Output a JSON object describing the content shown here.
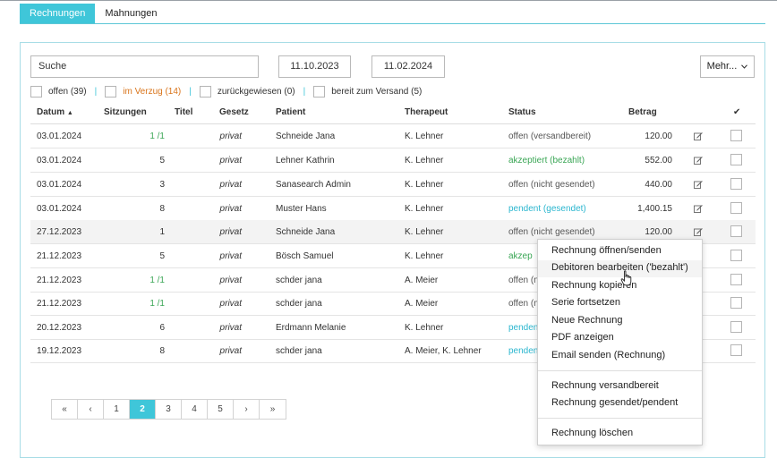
{
  "tabs": [
    {
      "label": "Rechnungen",
      "active": true
    },
    {
      "label": "Mahnungen",
      "active": false
    }
  ],
  "toolbar": {
    "search_placeholder": "Suche",
    "date_from": "11.10.2023",
    "date_to": "11.02.2024",
    "more_label": "Mehr..."
  },
  "filters": [
    {
      "label": "offen (39)",
      "color": "#333333"
    },
    {
      "label": "im Verzug (14)",
      "color": "#d9741a"
    },
    {
      "label": "zurückgewiesen (0)",
      "color": "#333333"
    },
    {
      "label": "bereit zum Versand (5)",
      "color": "#333333"
    }
  ],
  "table": {
    "headers": {
      "datum": "Datum",
      "sort_indicator": "▲",
      "sitzungen": "Sitzungen",
      "titel": "Titel",
      "gesetz": "Gesetz",
      "patient": "Patient",
      "therapeut": "Therapeut",
      "status": "Status",
      "betrag": "Betrag",
      "check": "✔"
    },
    "rows": [
      {
        "datum": "03.01.2024",
        "sitzungen": "1 /1",
        "sitz_green": true,
        "gesetz": "privat",
        "patient": "Schneide Jana",
        "therapeut": "K. Lehner",
        "status": "offen (versandbereit)",
        "status_color": "grey",
        "betrag": "120.00"
      },
      {
        "datum": "03.01.2024",
        "sitzungen": "5",
        "sitz_green": false,
        "gesetz": "privat",
        "patient": "Lehner Kathrin",
        "therapeut": "K. Lehner",
        "status": "akzeptiert (bezahlt)",
        "status_color": "green",
        "betrag": "552.00"
      },
      {
        "datum": "03.01.2024",
        "sitzungen": "3",
        "sitz_green": false,
        "gesetz": "privat",
        "patient": "Sanasearch Admin",
        "therapeut": "K. Lehner",
        "status": "offen (nicht gesendet)",
        "status_color": "grey",
        "betrag": "440.00"
      },
      {
        "datum": "03.01.2024",
        "sitzungen": "8",
        "sitz_green": false,
        "gesetz": "privat",
        "patient": "Muster Hans",
        "therapeut": "K. Lehner",
        "status": "pendent (gesendet)",
        "status_color": "blue",
        "betrag": "1,400.15"
      },
      {
        "datum": "27.12.2023",
        "sitzungen": "1",
        "sitz_green": false,
        "gesetz": "privat",
        "patient": "Schneide Jana",
        "therapeut": "K. Lehner",
        "status": "offen (nicht gesendet)",
        "status_color": "grey",
        "betrag": "120.00"
      },
      {
        "datum": "21.12.2023",
        "sitzungen": "5",
        "sitz_green": false,
        "gesetz": "privat",
        "patient": "Bösch Samuel",
        "therapeut": "K. Lehner",
        "status": "akzep",
        "status_color": "green",
        "betrag": ""
      },
      {
        "datum": "21.12.2023",
        "sitzungen": "1 /1",
        "sitz_green": true,
        "gesetz": "privat",
        "patient": "schder jana",
        "therapeut": "A. Meier",
        "status": "offen (n",
        "status_color": "grey",
        "betrag": ""
      },
      {
        "datum": "21.12.2023",
        "sitzungen": "1 /1",
        "sitz_green": true,
        "gesetz": "privat",
        "patient": "schder jana",
        "therapeut": "A. Meier",
        "status": "offen (n",
        "status_color": "grey",
        "betrag": ""
      },
      {
        "datum": "20.12.2023",
        "sitzungen": "6",
        "sitz_green": false,
        "gesetz": "privat",
        "patient": "Erdmann Melanie",
        "therapeut": "K. Lehner",
        "status": "penden",
        "status_color": "blue",
        "betrag": ""
      },
      {
        "datum": "19.12.2023",
        "sitzungen": "8",
        "sitz_green": false,
        "gesetz": "privat",
        "patient": "schder jana",
        "therapeut": "A. Meier, K. Lehner",
        "status": "penden",
        "status_color": "blue",
        "betrag": ""
      }
    ]
  },
  "pagination": {
    "items": [
      "«",
      "‹",
      "1",
      "2",
      "3",
      "4",
      "5",
      "›",
      "»"
    ],
    "active": "2"
  },
  "context_menu": {
    "group1": [
      "Rechnung öffnen/senden",
      "Debitoren bearbeiten ('bezahlt')",
      "Rechnung kopieren",
      "Serie fortsetzen",
      "Neue Rechnung",
      "PDF anzeigen",
      "Email senden (Rechnung)"
    ],
    "group2": [
      "Rechnung versandbereit",
      "Rechnung gesendet/pendent"
    ],
    "group3": [
      "Rechnung löschen"
    ],
    "hovered": "Debitoren bearbeiten ('bezahlt')"
  },
  "colors": {
    "accent": "#3fc6d9",
    "green": "#3aa655",
    "orange": "#d9741a",
    "blue": "#2bb6cf"
  },
  "icons": {
    "edit": "edit-icon",
    "dropdown": "chevron-down-icon",
    "sort": "sort-asc-icon",
    "cursor": "hand-pointer-icon"
  }
}
